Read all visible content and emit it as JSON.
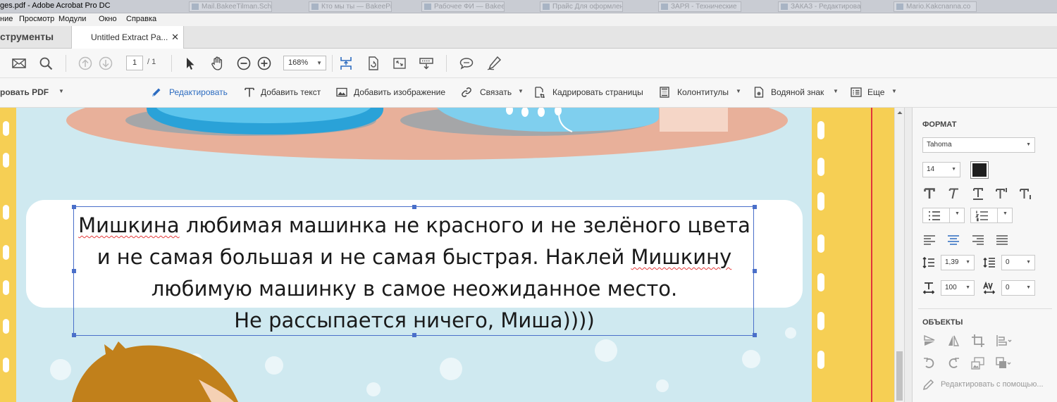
{
  "window": {
    "title": "ges.pdf - Adobe Acrobat Pro DC",
    "taskbar_items": [
      "Mail.BakeeTilman.Schep",
      "Кто мы ты — BakeePix",
      "Рабочее ФИ — BakeePix",
      "Прайс Для оформления",
      "ЗАРЯ - Технические",
      "ЗАКАЗ - Редактирование",
      "Mario.Kakcnanna.co"
    ]
  },
  "menu": {
    "items": [
      "ние",
      "Просмотр",
      "Модули",
      "Окно",
      "Справка"
    ]
  },
  "tabs": {
    "tools_label": "струменты",
    "doc_label": "Untitled Extract Pa...",
    "close": "✕"
  },
  "toolbar": {
    "page_current": "1",
    "page_total": "/ 1",
    "zoom": "168%",
    "dropdown": "▼"
  },
  "edit_toolbar": {
    "export_label": "ровать PDF",
    "edit_label": "Редактировать",
    "add_text_label": "Добавить текст",
    "add_image_label": "Добавить изображение",
    "link_label": "Связать",
    "crop_label": "Кадрировать страницы",
    "header_footer_label": "Колонтитулы",
    "watermark_label": "Водяной знак",
    "more_label": "Еще",
    "dropdown": "▼",
    "accent_color": "#2d6cc0"
  },
  "document": {
    "text_lines": [
      {
        "before": "",
        "sq": "Мишкина",
        "after": " любимая машинка не красного и не зелёного цвета"
      },
      {
        "before": "и не самая большая и не самая быстрая. Наклей ",
        "sq": "Мишкину",
        "after": ""
      },
      {
        "before": "любимую машинку в самое неожиданное место.",
        "sq": "",
        "after": ""
      },
      {
        "before": "Не рассыпается ничего, Миша))))",
        "sq": "",
        "after": ""
      }
    ]
  },
  "format_panel": {
    "format_heading": "ФОРМАТ",
    "font": "Tahoma",
    "font_size": "14",
    "text_color": "#1f1f1f",
    "line_spacing": "1,39",
    "para_spacing": "0",
    "scale": "100",
    "char_spacing": "0",
    "objects_heading": "ОБЪЕКТЫ",
    "edit_using": "Редактировать с помощью...",
    "dropdown": "▼"
  }
}
